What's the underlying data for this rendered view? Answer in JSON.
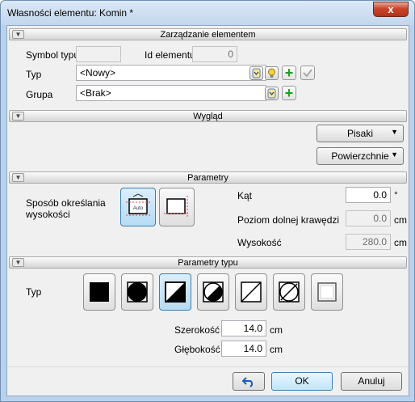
{
  "window": {
    "title": "Własności elementu: Komin *",
    "close_label": "x"
  },
  "sections": {
    "management": "Zarządzanie elementem",
    "appearance": "Wygląd",
    "parameters": "Parametry",
    "type_parameters": "Parametry typu"
  },
  "management": {
    "symbol_label": "Symbol typu",
    "symbol_value": "",
    "id_label": "Id elementu",
    "id_value": "0",
    "type_label": "Typ",
    "type_value": "<Nowy>",
    "group_label": "Grupa",
    "group_value": "<Brak>"
  },
  "appearance": {
    "pens_label": "Pisaki",
    "surfaces_label": "Powierzchnie"
  },
  "parameters": {
    "height_method_label": "Sposób określania wysokości",
    "auto_label": "Auto",
    "angle_label": "Kąt",
    "angle_value": "0.0",
    "angle_unit": "°",
    "bottom_level_label": "Poziom dolnej krawędzi",
    "bottom_level_value": "0.0",
    "bottom_level_unit": "cm",
    "height_label": "Wysokość",
    "height_value": "280.0",
    "height_unit": "cm"
  },
  "type_parameters": {
    "type_label": "Typ",
    "width_label": "Szerokość",
    "width_value": "14.0",
    "width_unit": "cm",
    "depth_label": "Głębokość",
    "depth_value": "14.0",
    "depth_unit": "cm",
    "selected_shape_index": 2
  },
  "footer": {
    "ok_label": "OK",
    "cancel_label": "Anuluj"
  }
}
